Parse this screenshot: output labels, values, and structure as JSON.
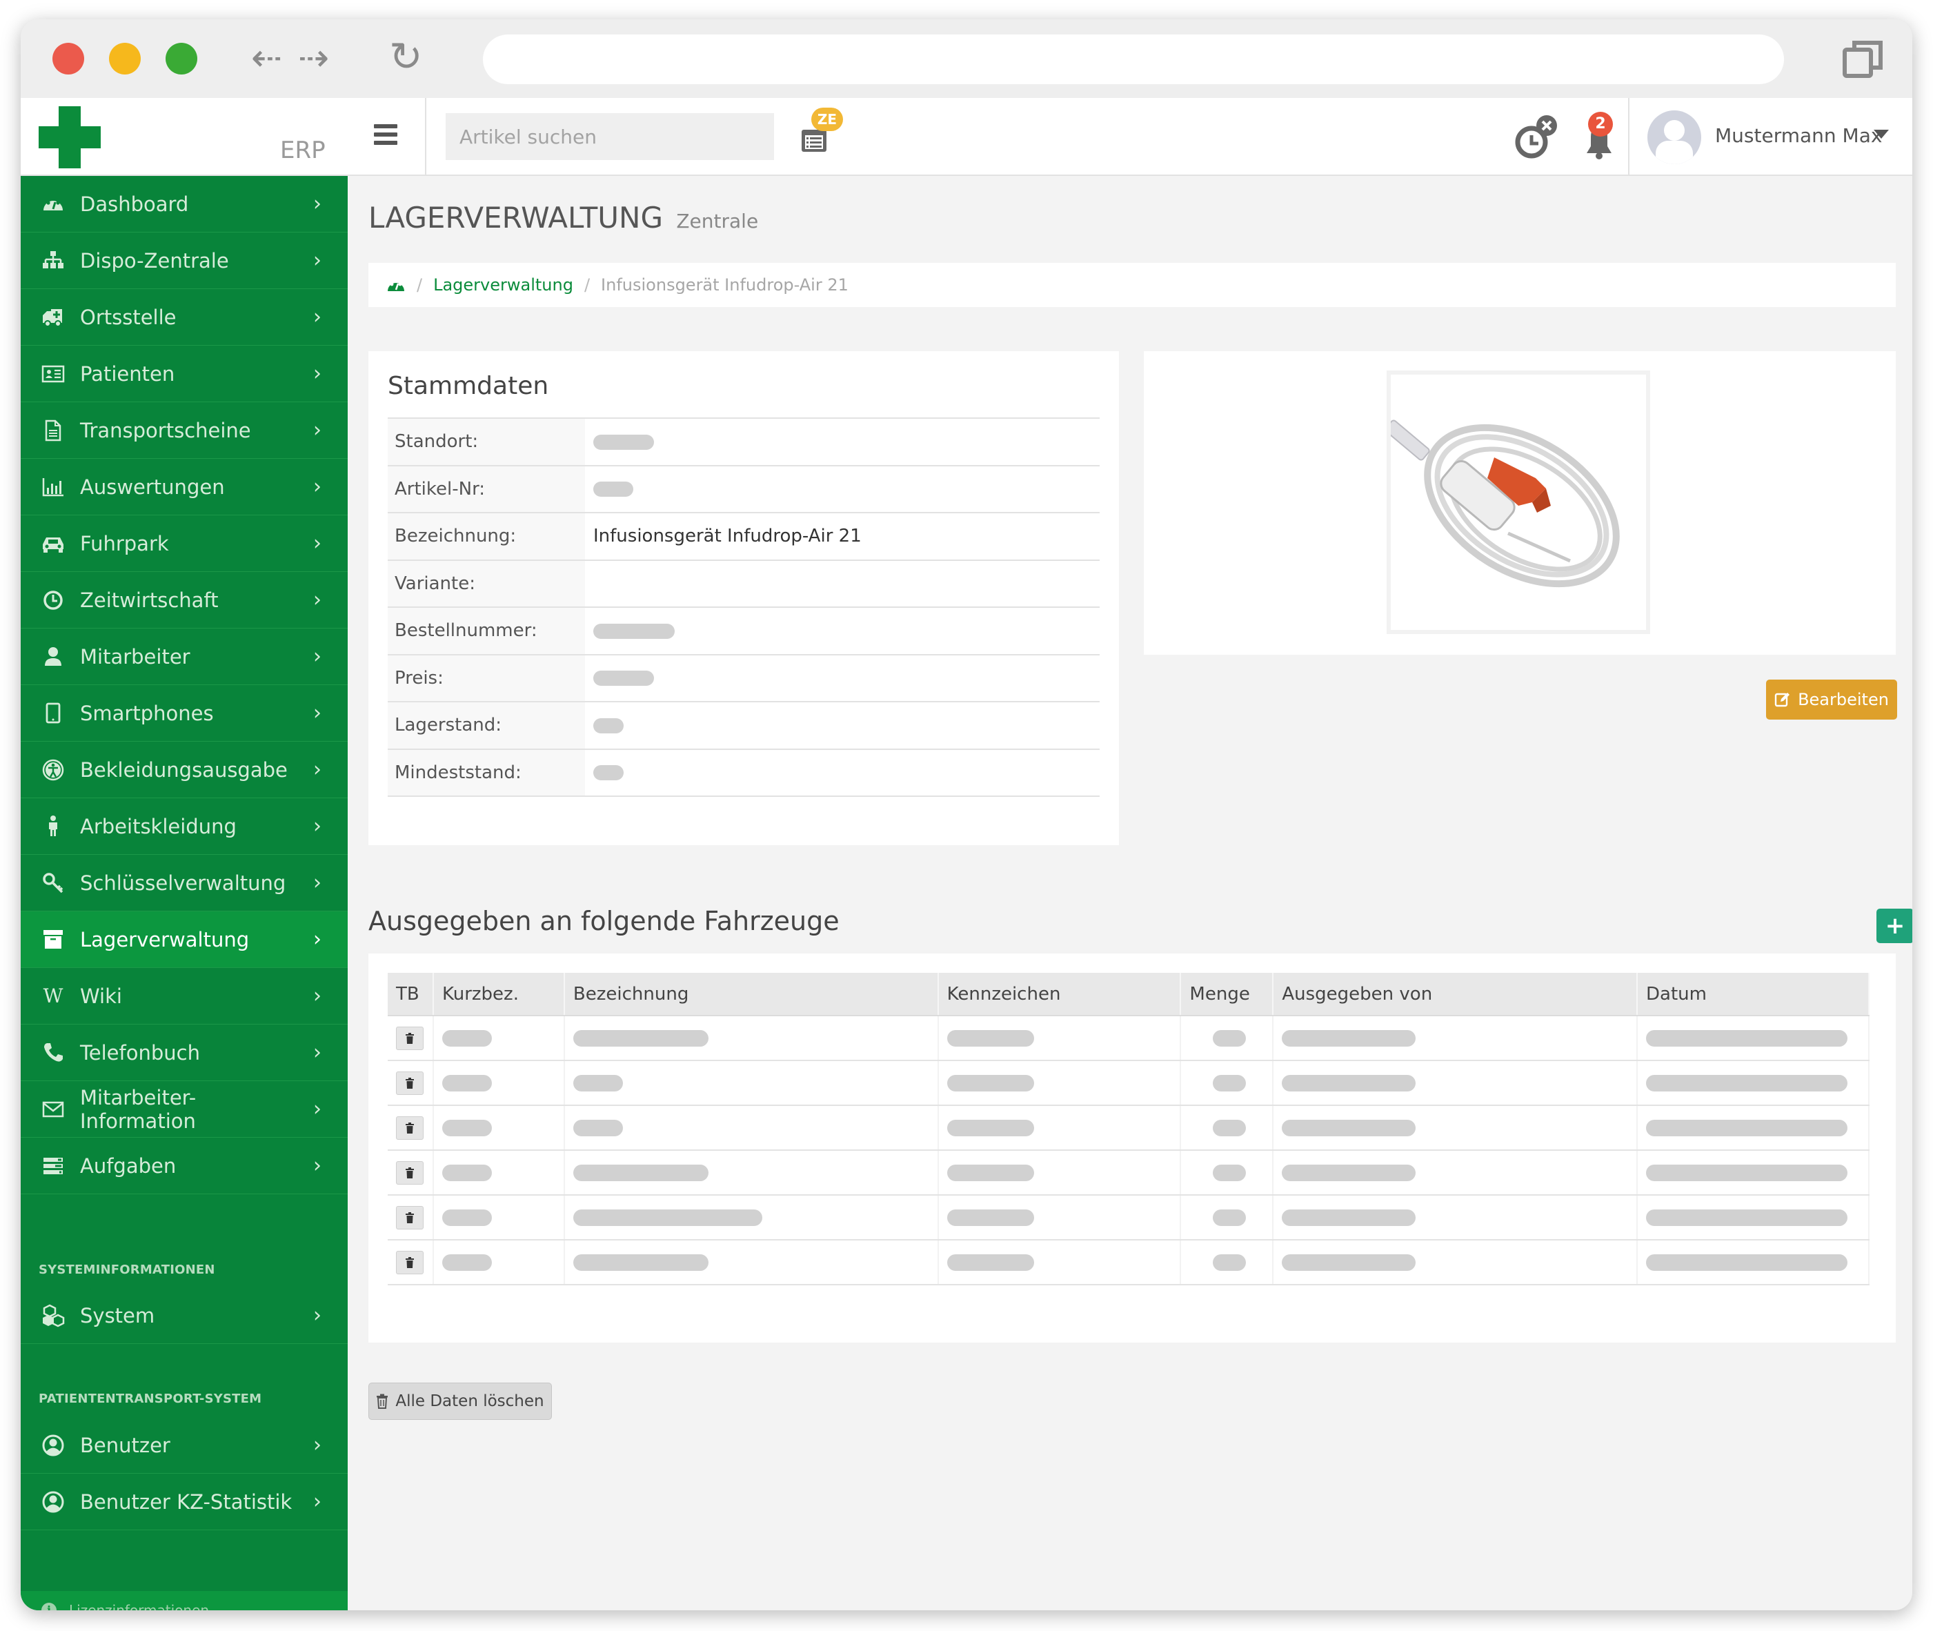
{
  "browser": {
    "url": "",
    "back_glyph": "⇠",
    "forward_glyph": "⇢",
    "reload_glyph": "↻"
  },
  "header": {
    "brand": "ERP",
    "search_placeholder": "Artikel suchen",
    "ze_badge": "ZE",
    "notifications_count": "2",
    "user_name": "Mustermann Max",
    "icons": [
      "menu-icon",
      "time-entry-list-icon",
      "clock-cancel-icon",
      "bell-icon",
      "user-avatar-icon",
      "caret-down-icon"
    ]
  },
  "sidebar": {
    "items": [
      {
        "label": "Dashboard",
        "icon": "dashboard-gauge-icon"
      },
      {
        "label": "Dispo-Zentrale",
        "icon": "sitemap-icon"
      },
      {
        "label": "Ortsstelle",
        "icon": "ambulance-icon"
      },
      {
        "label": "Patienten",
        "icon": "id-card-icon"
      },
      {
        "label": "Transportscheine",
        "icon": "document-icon"
      },
      {
        "label": "Auswertungen",
        "icon": "bar-chart-icon"
      },
      {
        "label": "Fuhrpark",
        "icon": "car-icon"
      },
      {
        "label": "Zeitwirtschaft",
        "icon": "clock-icon"
      },
      {
        "label": "Mitarbeiter",
        "icon": "user-icon"
      },
      {
        "label": "Smartphones",
        "icon": "tablet-icon"
      },
      {
        "label": "Bekleidungsausgabe",
        "icon": "universal-access-icon"
      },
      {
        "label": "Arbeitskleidung",
        "icon": "male-figure-icon"
      },
      {
        "label": "Schlüsselverwaltung",
        "icon": "key-icon"
      },
      {
        "label": "Lagerverwaltung",
        "icon": "archive-box-icon",
        "active": true
      },
      {
        "label": "Wiki",
        "icon": "wikipedia-w-icon"
      },
      {
        "label": "Telefonbuch",
        "icon": "phone-icon"
      },
      {
        "label": "Mitarbeiter-Information",
        "icon": "envelope-icon"
      },
      {
        "label": "Aufgaben",
        "icon": "tasks-icon"
      }
    ],
    "sections": [
      {
        "title": "SYSTEMINFORMATIONEN",
        "items": [
          {
            "label": "System",
            "icon": "cubes-icon"
          }
        ]
      },
      {
        "title": "PATIENTENTRANSPORT-SYSTEM",
        "items": [
          {
            "label": "Benutzer",
            "icon": "user-circle-icon"
          },
          {
            "label": "Benutzer KZ-Statistik",
            "icon": "user-circle-icon"
          }
        ]
      }
    ],
    "footer": {
      "label": "Lizenzinformationen",
      "icon_glyph": "i"
    },
    "chevron": "›"
  },
  "page": {
    "title": "LAGERVERWALTUNG",
    "subtitle": "Zentrale",
    "breadcrumb": {
      "link": "Lagerverwaltung",
      "current": "Infusionsgerät Infudrop-Air 21",
      "separator": "/"
    }
  },
  "stammdaten": {
    "title": "Stammdaten",
    "rows": [
      {
        "label": "Standort:",
        "value": null,
        "redacted": true
      },
      {
        "label": "Artikel-Nr:",
        "value": null,
        "redacted": true
      },
      {
        "label": "Bezeichnung:",
        "value": "Infusionsgerät Infudrop-Air 21",
        "redacted": false
      },
      {
        "label": "Variante:",
        "value": "",
        "redacted": false
      },
      {
        "label": "Bestellnummer:",
        "value": null,
        "redacted": true
      },
      {
        "label": "Preis:",
        "value": null,
        "redacted": true
      },
      {
        "label": "Lagerstand:",
        "value": null,
        "redacted": true
      },
      {
        "label": "Mindeststand:",
        "value": null,
        "redacted": true
      }
    ]
  },
  "product_image": {
    "alt": "Infusionsgerät Infudrop-Air 21",
    "accent_color": "#d9532a"
  },
  "actions": {
    "edit_label": "Bearbeiten",
    "add_label": "+",
    "clear_all_label": "Alle Daten löschen"
  },
  "vehicles": {
    "title": "Ausgegeben an folgende Fahrzeuge",
    "columns": [
      "TB",
      "Kurzbez.",
      "Bezeichnung",
      "Kennzeichen",
      "Menge",
      "Ausgegeben von",
      "Datum"
    ],
    "rows": [
      {
        "kurzbez": null,
        "bezeichnung": null,
        "kennzeichen": null,
        "menge": null,
        "ausgegeben_von": null,
        "datum": null,
        "redacted": true
      },
      {
        "kurzbez": null,
        "bezeichnung": null,
        "kennzeichen": null,
        "menge": null,
        "ausgegeben_von": null,
        "datum": null,
        "redacted": true
      },
      {
        "kurzbez": null,
        "bezeichnung": null,
        "kennzeichen": null,
        "menge": null,
        "ausgegeben_von": null,
        "datum": null,
        "redacted": true
      },
      {
        "kurzbez": null,
        "bezeichnung": null,
        "kennzeichen": null,
        "menge": null,
        "ausgegeben_von": null,
        "datum": null,
        "redacted": true
      },
      {
        "kurzbez": null,
        "bezeichnung": null,
        "kennzeichen": null,
        "menge": null,
        "ausgegeben_von": null,
        "datum": null,
        "redacted": true
      },
      {
        "kurzbez": null,
        "bezeichnung": null,
        "kennzeichen": null,
        "menge": null,
        "ausgegeben_von": null,
        "datum": null,
        "redacted": true
      }
    ]
  },
  "colors": {
    "brand_green": "#08843a",
    "active_green": "#0c973f",
    "edit_orange": "#dea02b",
    "add_teal": "#1fa27a",
    "badge_red": "#e9553c",
    "badge_yellow": "#f2b835"
  }
}
